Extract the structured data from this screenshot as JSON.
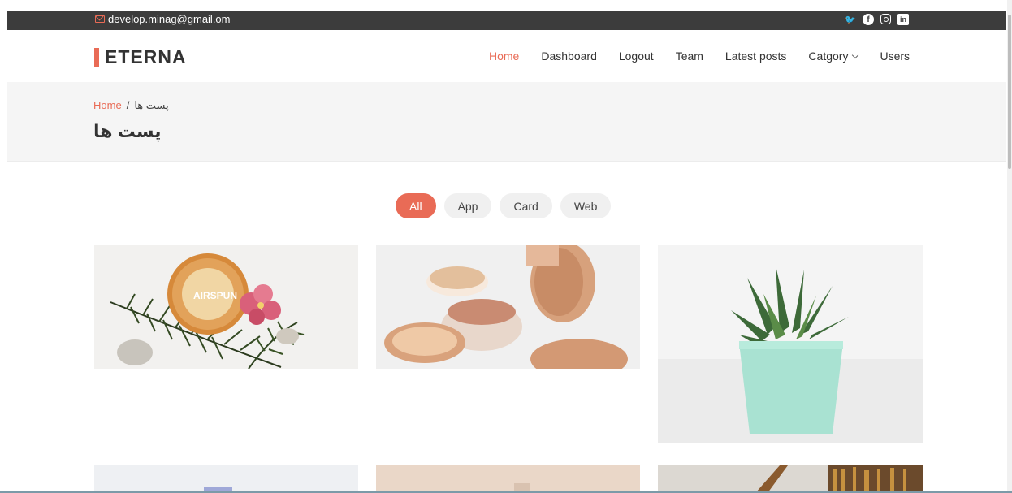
{
  "topbar": {
    "email": "develop.minag@gmail.om",
    "social": [
      "twitter-icon",
      "facebook-icon",
      "instagram-icon",
      "linkedin-icon"
    ]
  },
  "header": {
    "logo": "ETERNA",
    "nav": [
      {
        "label": "Home",
        "active": true
      },
      {
        "label": "Dashboard"
      },
      {
        "label": "Logout"
      },
      {
        "label": "Team"
      },
      {
        "label": "Latest posts"
      },
      {
        "label": "Catgory",
        "dropdown": true
      },
      {
        "label": "Users"
      }
    ]
  },
  "breadcrumbs": {
    "home": "Home",
    "separator": "/",
    "current": "پست ها",
    "title": "پست ها"
  },
  "filters": [
    "All",
    "App",
    "Card",
    "Web"
  ],
  "colors": {
    "accent": "#e96b56",
    "topbar": "#3c3c3c",
    "breadcrumb_bg": "#f5f5f5"
  }
}
